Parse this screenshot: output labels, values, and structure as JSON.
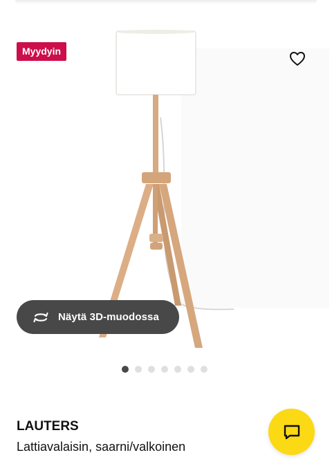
{
  "badge": {
    "label": "Myydyin",
    "color": "#cc0e4a"
  },
  "favorite": {
    "icon": "heart-outline-icon"
  },
  "viewer": {
    "label": "Näytä 3D-muodossa",
    "icon": "rotate-3d-icon"
  },
  "carousel": {
    "total": 7,
    "active_index": 0
  },
  "product": {
    "name": "LAUTERS",
    "description": "Lattiavalaisin, saarni/valkoinen"
  },
  "chat": {
    "icon": "chat-bubble-icon",
    "color": "#fbd914"
  }
}
